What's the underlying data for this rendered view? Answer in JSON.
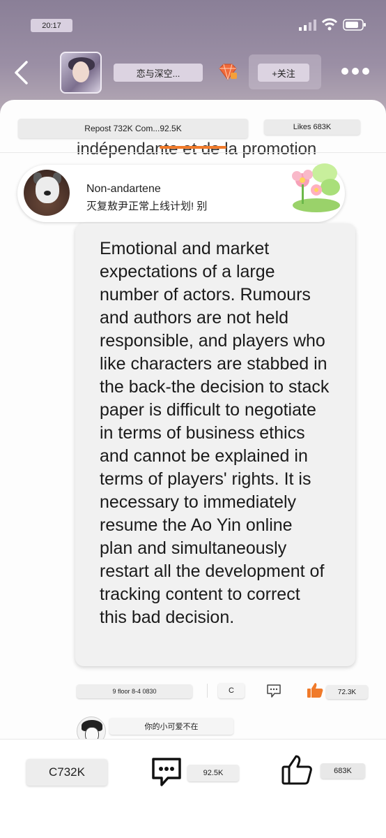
{
  "status_bar": {
    "time": "20:17",
    "icons": [
      "signal-icon",
      "wifi-icon",
      "battery-icon"
    ]
  },
  "header": {
    "back_icon": "chevron-left-icon",
    "group_name": "恋与深空...",
    "badge_icon": "gem-badge-icon",
    "follow_label": "+关注",
    "more_icon": "more-dots-icon"
  },
  "tabs": {
    "repost_comments": "Repost 732K Com...92.5K",
    "likes": "Likes 683K"
  },
  "background_text": "indépendante et de la promotion",
  "comment": {
    "user_name": "Non-andartene",
    "snippet": "灭复敖尹正常上线计划! 别",
    "body": "Emotional and market expectations of a large number of actors. Rumours and authors are not held responsible, and players who like characters are stabbed in the back-the decision to stack paper is difficult to negotiate in terms of business ethics and cannot be explained in terms of players' rights. It is necessary to immediately resume the Ao Yin online plan and simultaneously restart all the development of tracking content to correct this bad decision.",
    "floor_info": "9 floor 8-4 0830",
    "c_label": "C",
    "like_count": "72.3K"
  },
  "reply": {
    "text": "你的小可爱不在"
  },
  "bottom": {
    "repost_label": "C732K",
    "comment_count": "92.5K",
    "like_count": "683K"
  },
  "colors": {
    "accent": "#f07a2a",
    "header_bg": "#8a7f97"
  }
}
